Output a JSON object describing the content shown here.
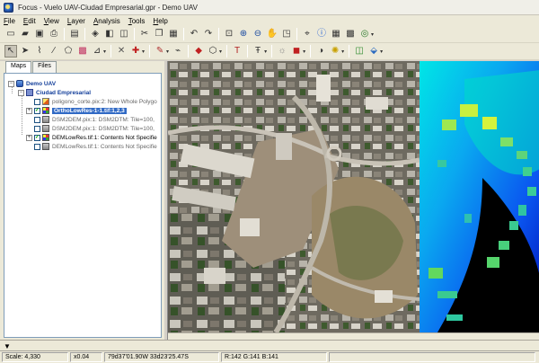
{
  "window": {
    "title": "Focus - Vuelo UAV-Ciudad Empresarial.gpr - Demo UAV"
  },
  "menu": [
    "File",
    "Edit",
    "View",
    "Layer",
    "Analysis",
    "Tools",
    "Help"
  ],
  "toolbar1_icons": [
    "new-icon",
    "open-icon",
    "save-icon",
    "print-icon",
    "sep",
    "layer-icon",
    "sep",
    "pan-layer-icon",
    "stack-icon",
    "layers-icon",
    "sep",
    "cut-icon",
    "copy-icon",
    "paste-icon",
    "sep",
    "undo-icon",
    "redo-icon",
    "sep",
    "zoom-extent-icon",
    "zoom-in-icon",
    "zoom-out-icon",
    "pan-hand-icon",
    "zoom-window-icon",
    "sep",
    "coordinate-icon",
    "info-icon",
    "table-icon",
    "grid-icon",
    "globe-icon"
  ],
  "toolbar2_icons": [
    "select-icon",
    "pointer-icon",
    "edit-vertex-icon",
    "draw-line-icon",
    "draw-polygon-icon",
    "color-grid-icon",
    "measure-icon",
    "sep",
    "split-icon",
    "merge-icon",
    "sep",
    "pen-icon",
    "polyline-icon",
    "sep",
    "paint-icon",
    "polygon-style-icon",
    "sep",
    "text-icon",
    "sep",
    "text-style-icon",
    "sep",
    "symbol-icon",
    "fill-icon",
    "sep",
    "contrast-icon",
    "sun-icon",
    "sep",
    "layer-stack-icon",
    "3d-layer-icon"
  ],
  "sidebar": {
    "tabs": [
      "Maps",
      "Files"
    ],
    "tree": [
      {
        "label": "Demo UAV",
        "style": "bold",
        "icon": "project",
        "expander": "−",
        "check": "",
        "level": 0
      },
      {
        "label": "Ciudad Empresarial",
        "style": "bold",
        "icon": "group",
        "expander": "−",
        "check": "",
        "level": 1
      },
      {
        "label": "poligono_corte.pix:2: New Whole Polygo",
        "style": "grey",
        "icon": "vector",
        "expander": "",
        "check": "",
        "level": 2
      },
      {
        "label": "OrthoLowRes-1-1.tif:1,2,3",
        "style": "selected",
        "icon": "raster",
        "expander": "+",
        "check": "✓",
        "level": 2
      },
      {
        "label": "DSM2DEM.pix:1: DSM2DTM: Tile=100,",
        "style": "grey",
        "icon": "dem",
        "expander": "",
        "check": "",
        "level": 2
      },
      {
        "label": "DSM2DEM.pix:1: DSM2DTM: Tile=100,",
        "style": "grey",
        "icon": "dem",
        "expander": "",
        "check": "",
        "level": 2
      },
      {
        "label": "DEMLowRes.tif:1: Contents Not Specifie",
        "style": "normal",
        "icon": "raster",
        "expander": "+",
        "check": "✓",
        "level": 2
      },
      {
        "label": "DEMLowRes.tif:1: Contents Not Specifie",
        "style": "grey",
        "icon": "dem",
        "expander": "",
        "check": "",
        "level": 2
      }
    ]
  },
  "status": {
    "scale": "Scale: 4,330",
    "zoom": "x0.04",
    "coords": "79d37'01.90W  33d23'25.47S",
    "rgb": "R:142 G:141 B:141"
  }
}
